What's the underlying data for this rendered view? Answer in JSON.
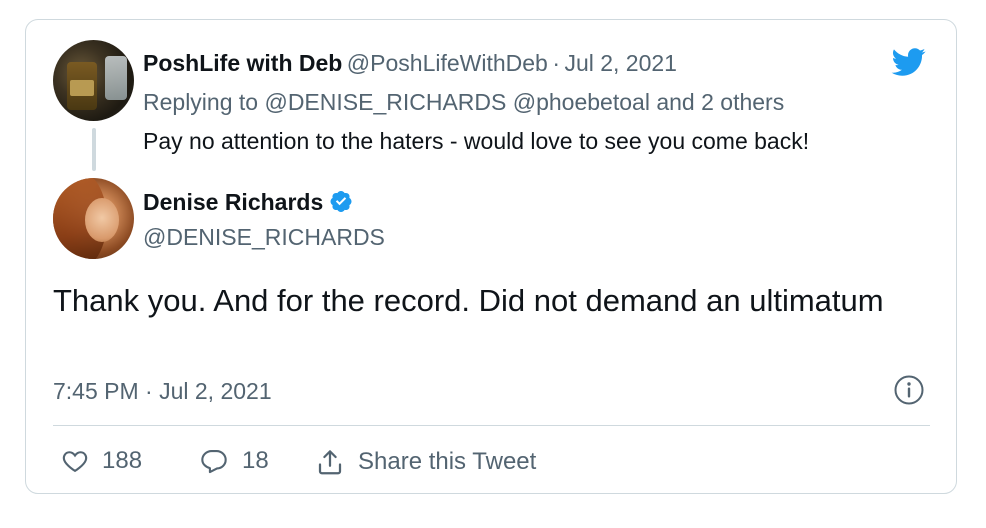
{
  "colors": {
    "twitter_blue": "#1d9bf0",
    "text_primary": "#0f1419",
    "text_secondary": "#536471",
    "border": "#cfd9de"
  },
  "parent_tweet": {
    "author_name": "PoshLife with Deb",
    "handle": "@PoshLifeWithDeb",
    "separator": "·",
    "date": "Jul 2, 2021",
    "replying_prefix": "Replying to",
    "replying_to": "@DENISE_RICHARDS @phoebetoal",
    "replying_suffix": "and 2 others",
    "text": "Pay no attention to the haters - would love to see you come back!",
    "avatar_icon": "profile-photo"
  },
  "main_tweet": {
    "author_name": "Denise Richards",
    "verified_icon": "verified-badge-icon",
    "handle": "@DENISE_RICHARDS",
    "text": "Thank you. And for the record. Did not demand an ultimatum",
    "timestamp": "7:45 PM · Jul 2, 2021",
    "avatar_icon": "profile-photo"
  },
  "actions": {
    "likes": "188",
    "replies": "18",
    "share_label": "Share this Tweet",
    "like_icon": "heart-icon",
    "reply_icon": "speech-bubble-icon",
    "share_icon": "share-icon",
    "info_icon": "info-icon"
  },
  "brand_icon": "twitter-bird-icon"
}
